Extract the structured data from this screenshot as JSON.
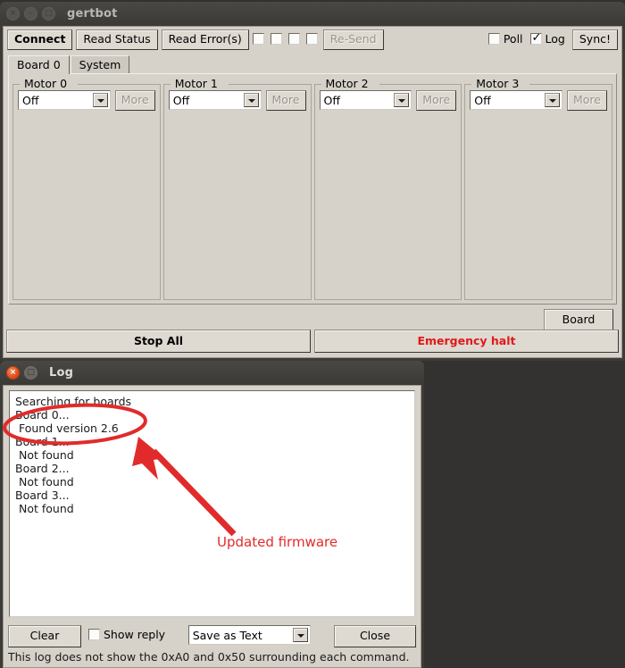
{
  "desktop": {
    "background": "#333231"
  },
  "main_window": {
    "title": "gertbot",
    "titlebar_buttons": [
      {
        "name": "close",
        "glyph": "×",
        "state": "inactive"
      },
      {
        "name": "minimize",
        "glyph": "–",
        "state": "inactive"
      },
      {
        "name": "maximize",
        "glyph": "□",
        "state": "inactive"
      }
    ],
    "toolbar": {
      "connect_label": "Connect",
      "read_status_label": "Read Status",
      "read_errors_label": "Read Error(s)",
      "resend_label": "Re-Send",
      "resend_disabled": true,
      "resend_checkboxes": [
        {
          "label": "",
          "checked": false
        },
        {
          "label": "",
          "checked": false
        },
        {
          "label": "",
          "checked": false
        },
        {
          "label": "",
          "checked": false
        }
      ],
      "poll_label": "Poll",
      "poll_checked": false,
      "log_label": "Log",
      "log_checked": true,
      "sync_label": "Sync!"
    },
    "tabs": [
      {
        "label": "Board 0",
        "active": true
      },
      {
        "label": "System",
        "active": false
      }
    ],
    "motors": [
      {
        "title": "Motor 0",
        "mode": "Off",
        "more_label": "More",
        "more_disabled": true
      },
      {
        "title": "Motor 1",
        "mode": "Off",
        "more_label": "More",
        "more_disabled": true
      },
      {
        "title": "Motor 2",
        "mode": "Off",
        "more_label": "More",
        "more_disabled": true
      },
      {
        "title": "Motor 3",
        "mode": "Off",
        "more_label": "More",
        "more_disabled": true
      }
    ],
    "board_button_label": "Board",
    "stop_all_label": "Stop All",
    "emergency_halt_label": "Emergency halt",
    "emergency_color": "#e01919"
  },
  "log_window": {
    "title": "Log",
    "titlebar_buttons": [
      {
        "name": "close",
        "glyph": "×",
        "state": "active"
      },
      {
        "name": "maximize",
        "glyph": "□",
        "state": "active"
      }
    ],
    "lines": [
      "Searching for boards",
      "Board 0...",
      " Found version 2.6",
      "Board 1...",
      " Not found",
      "Board 2...",
      " Not found",
      "Board 3...",
      " Not found"
    ],
    "clear_label": "Clear",
    "show_reply_label": "Show reply",
    "show_reply_checked": false,
    "save_option": "Save as Text",
    "close_label": "Close",
    "footer_note": "This log does not show the 0xA0 and 0x50 surrounding each command."
  },
  "annotation": {
    "color": "#e12b2b",
    "label": "Updated firmware",
    "ellipse_target": " Found version 2.6"
  }
}
